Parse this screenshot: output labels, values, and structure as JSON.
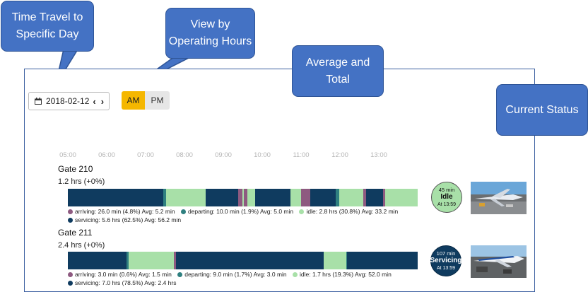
{
  "callouts": {
    "time_travel": "Time Travel to Specific Day",
    "view_hours": "View by Operating Hours",
    "average_total": "Average and Total",
    "current_status": "Current Status"
  },
  "controls": {
    "date": "2018-02-12",
    "prev": "‹",
    "next": "›",
    "am": "AM",
    "pm": "PM",
    "selected_period": "AM",
    "calendar_icon": "calendar-icon"
  },
  "axis_ticks": [
    "05:00",
    "06:00",
    "07:00",
    "08:00",
    "09:00",
    "10:00",
    "11:00",
    "12:00",
    "13:00"
  ],
  "colors": {
    "servicing": "#0f3b5f",
    "idle": "#a8e0a8",
    "arriving": "#8e5a80",
    "departing": "#2f8080",
    "am_active": "#f5b700",
    "callout": "#4472c4"
  },
  "gates": [
    {
      "name": "Gate 210",
      "total": "1.2 hrs (+0%)",
      "legend": {
        "arriving": "arriving: 26.0 min (4.8%) Avg: 5.2 min",
        "departing": "departing: 10.0 min (1.9%) Avg: 5.0 min",
        "idle": "idle: 2.8 hrs (30.8%) Avg: 33.2 min",
        "servicing": "servicing: 5.6 hrs (62.5%) Avg: 56.2 min"
      },
      "status": {
        "minutes": "45 min",
        "state": "Idle",
        "at": "At 13:59"
      }
    },
    {
      "name": "Gate 211",
      "total": "2.4 hrs (+0%)",
      "legend": {
        "arriving": "arriving: 3.0 min (0.6%) Avg: 1.5 min",
        "departing": "departing: 9.0 min (1.7%) Avg: 3.0 min",
        "idle": "idle: 1.7 hrs (19.3%) Avg: 52.0 min",
        "servicing": "servicing: 7.0 hrs (78.5%) Avg: 2.4 hrs"
      },
      "status": {
        "minutes": "107 min",
        "state": "Servicing",
        "at": "At 13:59"
      }
    }
  ]
}
